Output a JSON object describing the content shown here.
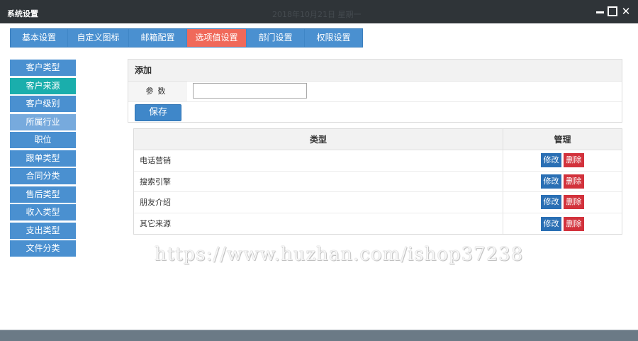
{
  "window": {
    "title": "系统设置",
    "ghost_text": "2018年10月21日 星期一",
    "minimize_label": "",
    "maximize_label": "",
    "close_label": "✕"
  },
  "tabs": [
    {
      "label": "基本设置"
    },
    {
      "label": "自定义图标"
    },
    {
      "label": "邮箱配置"
    },
    {
      "label": "选项值设置",
      "active": true
    },
    {
      "label": "部门设置"
    },
    {
      "label": "权限设置"
    }
  ],
  "sidebar": {
    "items": [
      {
        "label": "客户类型"
      },
      {
        "label": "客户来源",
        "active": true
      },
      {
        "label": "客户级别"
      },
      {
        "label": "所属行业",
        "hover": true
      },
      {
        "label": "职位"
      },
      {
        "label": "跟单类型"
      },
      {
        "label": "合同分类"
      },
      {
        "label": "售后类型"
      },
      {
        "label": "收入类型"
      },
      {
        "label": "支出类型"
      },
      {
        "label": "文件分类"
      }
    ]
  },
  "add_form": {
    "heading": "添加",
    "param_label": "参数",
    "param_value": "",
    "save_label": "保存"
  },
  "table": {
    "headers": {
      "type": "类型",
      "manage": "管理"
    },
    "edit_label": "修改",
    "delete_label": "删除",
    "rows": [
      {
        "type": "电话营销"
      },
      {
        "type": "搜索引擎"
      },
      {
        "type": "朋友介绍"
      },
      {
        "type": "其它来源"
      }
    ]
  },
  "watermark": "https://www.huzhan.com/ishop37238",
  "colors": {
    "titlebar": "#2f3438",
    "primary": "#4a90d0",
    "tab_active": "#f0695a",
    "side_active": "#1aaeac",
    "edit_button": "#2a6fb4",
    "delete_button": "#d2323c"
  }
}
